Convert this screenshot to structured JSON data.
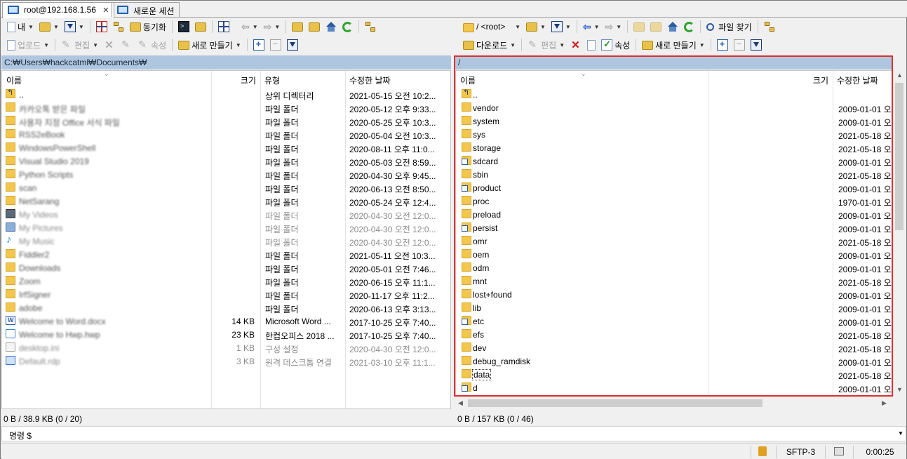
{
  "tabs": [
    {
      "label": "root@192.168.1.56",
      "close": "✕"
    },
    {
      "label": "새로운 세션"
    }
  ],
  "toolbar_left": {
    "location": "내",
    "sync": "동기화",
    "upload": "업로드",
    "edit": "편집",
    "properties": "속성",
    "new": "새로 만들기"
  },
  "toolbar_right": {
    "location": "/ <root>",
    "find": "파일 찾기",
    "download": "다운로드",
    "edit": "편집",
    "properties": "속성",
    "new": "새로 만들기"
  },
  "left_pane": {
    "path": "C:₩Users₩hackcatml₩Documents₩",
    "columns": {
      "name": "이름",
      "size": "크기",
      "type": "유형",
      "modified": "수정한 날짜"
    },
    "rows": [
      {
        "icon": "updir-icon",
        "name": "..",
        "size": "",
        "type": "상위 디렉터리",
        "date": "2021-05-15  오전 10:2...",
        "style": "normal"
      },
      {
        "icon": "folder-icon",
        "name": "카카오톡 받은 파일",
        "size": "",
        "type": "파일 폴더",
        "date": "2020-05-12  오후 9:33...",
        "style": "blur"
      },
      {
        "icon": "folder-icon",
        "name": "사용자 지정 Office 서식 파일",
        "size": "",
        "type": "파일 폴더",
        "date": "2020-05-25  오후 10:3...",
        "style": "blur"
      },
      {
        "icon": "folder-icon",
        "name": "RSS2eBook",
        "size": "",
        "type": "파일 폴더",
        "date": "2020-05-04  오전 10:3...",
        "style": "blur"
      },
      {
        "icon": "folder-icon",
        "name": "WindowsPowerShell",
        "size": "",
        "type": "파일 폴더",
        "date": "2020-08-11  오후 11:0...",
        "style": "blur"
      },
      {
        "icon": "folder-icon",
        "name": "Visual Studio 2019",
        "size": "",
        "type": "파일 폴더",
        "date": "2020-05-03  오전 8:59...",
        "style": "blur"
      },
      {
        "icon": "folder-icon",
        "name": "Python Scripts",
        "size": "",
        "type": "파일 폴더",
        "date": "2020-04-30  오후 9:45...",
        "style": "blur"
      },
      {
        "icon": "folder-icon",
        "name": "scan",
        "size": "",
        "type": "파일 폴더",
        "date": "2020-06-13  오전 8:50...",
        "style": "blur"
      },
      {
        "icon": "folder-icon",
        "name": "NetSarang",
        "size": "",
        "type": "파일 폴더",
        "date": "2020-05-24  오후 12:4...",
        "style": "blur"
      },
      {
        "icon": "video-icon",
        "name": "My Videos",
        "size": "",
        "type": "파일 폴더",
        "date": "2020-04-30  오전 12:0...",
        "style": "grayblur"
      },
      {
        "icon": "picture-icon",
        "name": "My Pictures",
        "size": "",
        "type": "파일 폴더",
        "date": "2020-04-30  오전 12:0...",
        "style": "grayblur"
      },
      {
        "icon": "music-icon",
        "name": "My Music",
        "size": "",
        "type": "파일 폴더",
        "date": "2020-04-30  오전 12:0...",
        "style": "grayblur"
      },
      {
        "icon": "folder-icon",
        "name": "Fiddler2",
        "size": "",
        "type": "파일 폴더",
        "date": "2021-05-11  오전 10:3...",
        "style": "blur"
      },
      {
        "icon": "folder-icon",
        "name": "Downloads",
        "size": "",
        "type": "파일 폴더",
        "date": "2020-05-01  오전 7:46...",
        "style": "blur"
      },
      {
        "icon": "folder-icon",
        "name": "Zoom",
        "size": "",
        "type": "파일 폴더",
        "date": "2020-06-15  오후 11:1...",
        "style": "blur"
      },
      {
        "icon": "folder-icon",
        "name": "IrfSigner",
        "size": "",
        "type": "파일 폴더",
        "date": "2020-11-17  오후 11:2...",
        "style": "blur"
      },
      {
        "icon": "folder-icon",
        "name": "adobe",
        "size": "",
        "type": "파일 폴더",
        "date": "2020-06-13  오후 3:13...",
        "style": "blur"
      },
      {
        "icon": "word-icon",
        "name": "Welcome to Word.docx",
        "size": "14 KB",
        "type": "Microsoft Word ...",
        "date": "2017-10-25  오후 7:40...",
        "style": "blur"
      },
      {
        "icon": "hwp-icon",
        "name": "Welcome to Hwp.hwp",
        "size": "23 KB",
        "type": "한컴오피스 2018 ...",
        "date": "2017-10-25  오후 7:40...",
        "style": "blur"
      },
      {
        "icon": "ini-icon",
        "name": "desktop.ini",
        "size": "1 KB",
        "type": "구성 설정",
        "date": "2020-04-30  오전 12:0...",
        "style": "grayblur"
      },
      {
        "icon": "rdp-icon",
        "name": "Default.rdp",
        "size": "3 KB",
        "type": "원격 데스크톱 연결",
        "date": "2021-03-10  오후 11:1...",
        "style": "grayblur"
      }
    ],
    "status": "0 B / 38.9 KB (0 / 20)"
  },
  "right_pane": {
    "path": "/",
    "columns": {
      "name": "이름",
      "size": "크기",
      "modified": "수정한 날짜"
    },
    "rows": [
      {
        "icon": "updir-icon",
        "name": "..",
        "date": ""
      },
      {
        "icon": "folder-icon",
        "name": "vendor",
        "date": "2009-01-01  오"
      },
      {
        "icon": "folder-icon",
        "name": "system",
        "date": "2009-01-01  오"
      },
      {
        "icon": "folder-icon",
        "name": "sys",
        "date": "2021-05-18  오"
      },
      {
        "icon": "folder-icon",
        "name": "storage",
        "date": "2021-05-18  오"
      },
      {
        "icon": "folder-link-icon",
        "name": "sdcard",
        "date": "2009-01-01  오"
      },
      {
        "icon": "folder-icon",
        "name": "sbin",
        "date": "2021-05-18  오"
      },
      {
        "icon": "folder-link-icon",
        "name": "product",
        "date": "2009-01-01  오"
      },
      {
        "icon": "folder-icon",
        "name": "proc",
        "date": "1970-01-01  오"
      },
      {
        "icon": "folder-icon",
        "name": "preload",
        "date": "2009-01-01  오"
      },
      {
        "icon": "folder-link-icon",
        "name": "persist",
        "date": "2009-01-01  오"
      },
      {
        "icon": "folder-icon",
        "name": "omr",
        "date": "2021-05-18  오"
      },
      {
        "icon": "folder-icon",
        "name": "oem",
        "date": "2009-01-01  오"
      },
      {
        "icon": "folder-icon",
        "name": "odm",
        "date": "2009-01-01  오"
      },
      {
        "icon": "folder-icon",
        "name": "mnt",
        "date": "2021-05-18  오"
      },
      {
        "icon": "folder-icon",
        "name": "lost+found",
        "date": "2009-01-01  오"
      },
      {
        "icon": "folder-icon",
        "name": "lib",
        "date": "2009-01-01  오"
      },
      {
        "icon": "folder-link-icon",
        "name": "etc",
        "date": "2009-01-01  오"
      },
      {
        "icon": "folder-icon",
        "name": "efs",
        "date": "2021-05-18  오"
      },
      {
        "icon": "folder-icon",
        "name": "dev",
        "date": "2021-05-18  오"
      },
      {
        "icon": "folder-icon",
        "name": "debug_ramdisk",
        "date": "2009-01-01  오"
      },
      {
        "icon": "folder-icon",
        "name": "data",
        "date": "2021-05-18  오"
      },
      {
        "icon": "folder-link-icon",
        "name": "d",
        "date": "2009-01-01  오"
      }
    ],
    "status": "0 B / 157 KB (0 / 46)"
  },
  "command_bar": {
    "label": "명령 $"
  },
  "statusbar": {
    "protocol": "SFTP-3",
    "elapsed": "0:00:25"
  },
  "colors": {
    "highlight": "#e03030",
    "path_bar": "#aec6df",
    "folder": "#f3c74d"
  }
}
